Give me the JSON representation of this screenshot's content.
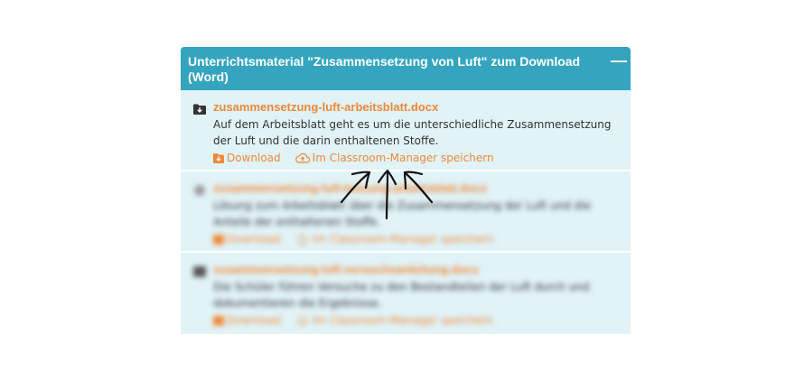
{
  "panel": {
    "title": "Unterrichtsmaterial \"Zusammensetzung von Luft\" zum Download (Word)",
    "collapse_symbol": "—"
  },
  "items": [
    {
      "filename": "zusammensetzung-luft-arbeitsblatt.docx",
      "description": "Auf dem Arbeitsblatt geht es um die unterschiedliche Zusammensetzung der Luft und die darin enthaltenen Stoffe.",
      "download_label": "Download",
      "save_label": "Im Classroom-Manager speichern"
    },
    {
      "filename": "zusammensetzung-luft-loesung-arbeitsblatt.docx",
      "description": "Lösung zum Arbeitsblatt über die Zusammensetzung der Luft und die Anteile der enthaltenen Stoffe.",
      "download_label": "Download",
      "save_label": "Im Classroom-Manager speichern"
    },
    {
      "filename": "zusammensetzung-luft-versuchsanleitung.docx",
      "description": "Die Schüler führen Versuche zu den Bestandteilen der Luft durch und dokumentieren die Ergebnisse.",
      "download_label": "Download",
      "save_label": "Im Classroom-Manager speichern"
    }
  ],
  "icons": {
    "file": "file-download-icon",
    "download": "download-icon",
    "cloud": "cloud-upload-icon",
    "annotation": "hand-drawn-arrows"
  },
  "colors": {
    "header": "#35a5bf",
    "item_bg": "#e1f3f7",
    "link": "#f0883a",
    "text": "#333333"
  }
}
